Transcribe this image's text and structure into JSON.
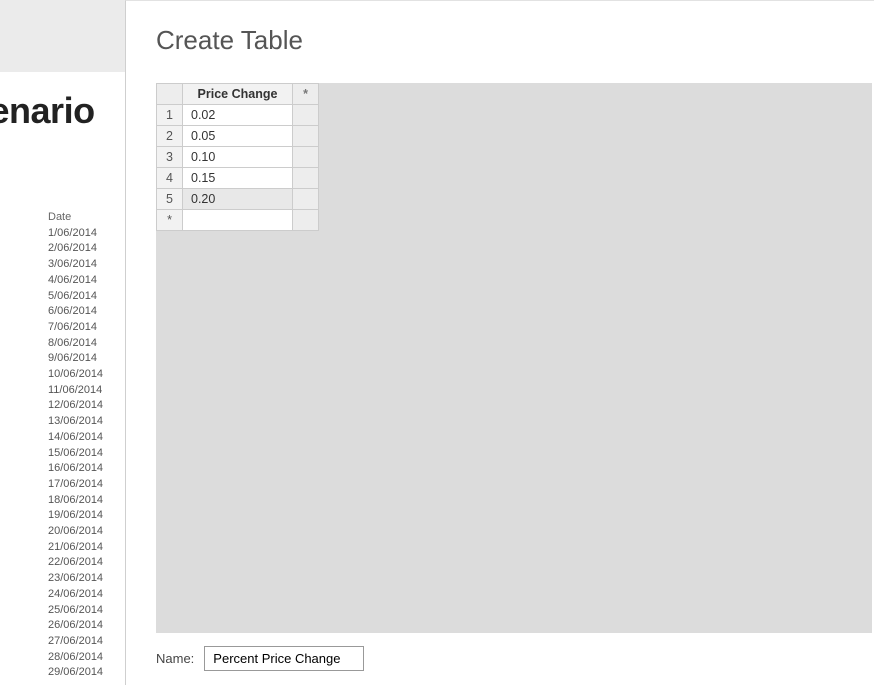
{
  "background": {
    "title_fragment": "cenario",
    "date_column_header": "Date",
    "dates": [
      "1/06/2014",
      "2/06/2014",
      "3/06/2014",
      "4/06/2014",
      "5/06/2014",
      "6/06/2014",
      "7/06/2014",
      "8/06/2014",
      "9/06/2014",
      "10/06/2014",
      "11/06/2014",
      "12/06/2014",
      "13/06/2014",
      "14/06/2014",
      "15/06/2014",
      "16/06/2014",
      "17/06/2014",
      "18/06/2014",
      "19/06/2014",
      "20/06/2014",
      "21/06/2014",
      "22/06/2014",
      "23/06/2014",
      "24/06/2014",
      "25/06/2014",
      "26/06/2014",
      "27/06/2014",
      "28/06/2014",
      "29/06/2014"
    ]
  },
  "dialog": {
    "title": "Create Table",
    "table": {
      "column_header": "Price Change",
      "new_col_marker": "*",
      "new_row_marker": "*",
      "rows": [
        {
          "n": "1",
          "v": "0.02"
        },
        {
          "n": "2",
          "v": "0.05"
        },
        {
          "n": "3",
          "v": "0.10"
        },
        {
          "n": "4",
          "v": "0.15"
        },
        {
          "n": "5",
          "v": "0.20"
        }
      ]
    },
    "name_label": "Name:",
    "name_value": "Percent Price Change"
  }
}
